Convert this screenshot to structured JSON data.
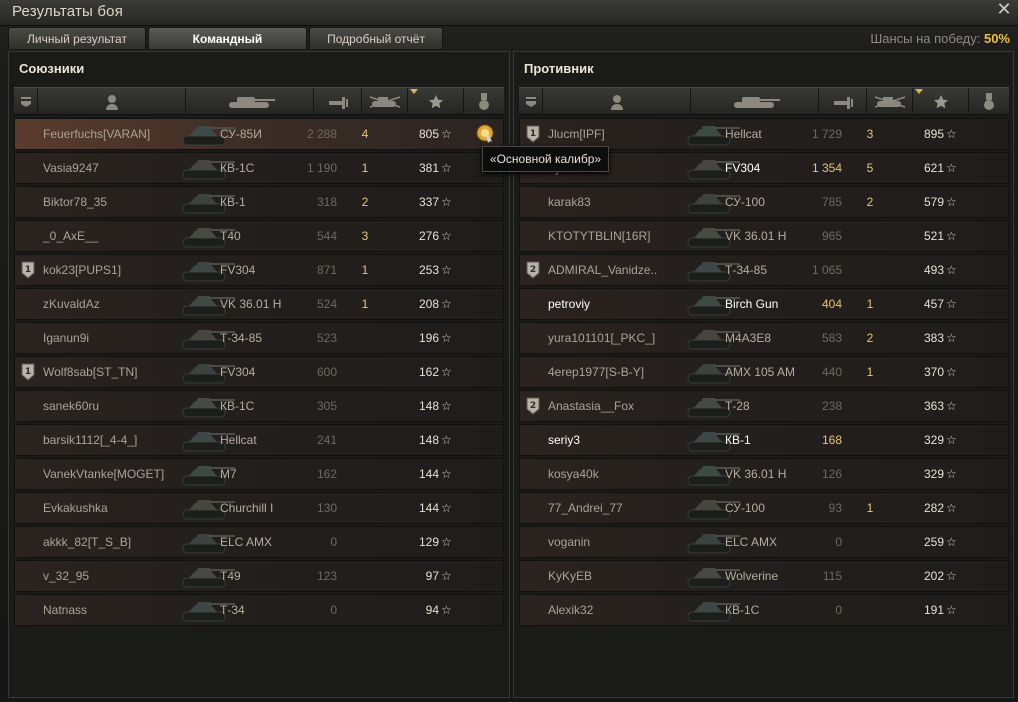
{
  "window": {
    "title": "Результаты боя",
    "close_label": "✕"
  },
  "tabs": [
    {
      "label": "Личный результат",
      "active": false
    },
    {
      "label": "Командный результат",
      "active": true
    },
    {
      "label": "Подробный отчёт",
      "active": false
    }
  ],
  "win_chance": {
    "label": "Шансы на победу:",
    "value": "50%"
  },
  "columns": {
    "icons": [
      "clan-badge-icon",
      "player-icon",
      "tank-icon",
      "damage-icon",
      "kills-icon",
      "xp-star-icon",
      "medal-icon"
    ],
    "sort_column": "xp"
  },
  "allies": {
    "title": "Союзники",
    "rows": [
      {
        "badge": "",
        "name": "Feuerfuchs[VARAN]",
        "tank": "СУ-85И",
        "damage": "2 288",
        "kills": "4",
        "xp": "805",
        "medal": "main-caliber",
        "me": true,
        "alive": false
      },
      {
        "badge": "",
        "name": "Vasia9247",
        "tank": "КВ-1С",
        "damage": "1 190",
        "kills": "1",
        "xp": "381",
        "medal": "",
        "alive": false
      },
      {
        "badge": "",
        "name": "Biktor78_35",
        "tank": "КВ-1",
        "damage": "318",
        "kills": "2",
        "xp": "337",
        "medal": "",
        "alive": false
      },
      {
        "badge": "",
        "name": "_0_AxE__",
        "tank": "T40",
        "damage": "544",
        "kills": "3",
        "xp": "276",
        "medal": "",
        "alive": false
      },
      {
        "badge": "1",
        "name": "kok23[PUPS1]",
        "tank": "FV304",
        "damage": "871",
        "kills": "1",
        "xp": "253",
        "medal": "",
        "alive": false
      },
      {
        "badge": "",
        "name": "zKuvaldAz",
        "tank": "VK 36.01 H",
        "damage": "524",
        "kills": "1",
        "xp": "208",
        "medal": "",
        "alive": false
      },
      {
        "badge": "",
        "name": "Iganun9i",
        "tank": "Т-34-85",
        "damage": "523",
        "kills": "",
        "xp": "196",
        "medal": "",
        "alive": false
      },
      {
        "badge": "1",
        "name": "Wolf8sab[ST_TN]",
        "tank": "FV304",
        "damage": "600",
        "kills": "",
        "xp": "162",
        "medal": "",
        "alive": false
      },
      {
        "badge": "",
        "name": "sanek60ru",
        "tank": "КВ-1С",
        "damage": "305",
        "kills": "",
        "xp": "148",
        "medal": "",
        "alive": false
      },
      {
        "badge": "",
        "name": "barsik1112[_4-4_]",
        "tank": "Hellcat",
        "damage": "241",
        "kills": "",
        "xp": "148",
        "medal": "",
        "alive": false
      },
      {
        "badge": "",
        "name": "VanekVtanke[MOGET]",
        "tank": "M7",
        "damage": "162",
        "kills": "",
        "xp": "144",
        "medal": "",
        "alive": false
      },
      {
        "badge": "",
        "name": "Evkakushka",
        "tank": "Churchill I",
        "damage": "130",
        "kills": "",
        "xp": "144",
        "medal": "",
        "alive": false
      },
      {
        "badge": "",
        "name": "akkk_82[T_S_B]",
        "tank": "ELC AMX",
        "damage": "0",
        "kills": "",
        "xp": "129",
        "medal": "",
        "alive": false
      },
      {
        "badge": "",
        "name": "v_32_95",
        "tank": "T49",
        "damage": "123",
        "kills": "",
        "xp": "97",
        "medal": "",
        "alive": false
      },
      {
        "badge": "",
        "name": "Natnass",
        "tank": "Т-34",
        "damage": "0",
        "kills": "",
        "xp": "94",
        "medal": "",
        "alive": false
      }
    ]
  },
  "enemies": {
    "title": "Противник",
    "rows": [
      {
        "badge": "1",
        "name": "Jlucm[IPF]",
        "tank": "Hellcat",
        "damage": "1 729",
        "kills": "3",
        "xp": "895",
        "medal": "",
        "alive": false
      },
      {
        "badge": "",
        "name": "F]",
        "tank": "FV304",
        "damage": "1 354",
        "kills": "5",
        "xp": "621",
        "medal": "",
        "alive": true
      },
      {
        "badge": "",
        "name": "karak83",
        "tank": "СУ-100",
        "damage": "785",
        "kills": "2",
        "xp": "579",
        "medal": "",
        "alive": false
      },
      {
        "badge": "",
        "name": "KTOTYTBLIN[16R]",
        "tank": "VK 36.01 H",
        "damage": "965",
        "kills": "",
        "xp": "521",
        "medal": "",
        "alive": false
      },
      {
        "badge": "2",
        "name": "ADMIRAL_Vanidze..",
        "tank": "Т-34-85",
        "damage": "1 065",
        "kills": "",
        "xp": "493",
        "medal": "",
        "alive": false
      },
      {
        "badge": "",
        "name": "petroviy",
        "tank": "Birch Gun",
        "damage": "404",
        "kills": "1",
        "xp": "457",
        "medal": "",
        "alive": true
      },
      {
        "badge": "",
        "name": "yura101101[_PKC_]",
        "tank": "M4A3E8",
        "damage": "583",
        "kills": "2",
        "xp": "383",
        "medal": "",
        "alive": false
      },
      {
        "badge": "",
        "name": "4erep1977[S-B-Y]",
        "tank": "AMX 105 AM",
        "damage": "440",
        "kills": "1",
        "xp": "370",
        "medal": "",
        "alive": false
      },
      {
        "badge": "2",
        "name": "Anastasia__Fox",
        "tank": "Т-28",
        "damage": "238",
        "kills": "",
        "xp": "363",
        "medal": "",
        "alive": false
      },
      {
        "badge": "",
        "name": "seriy3",
        "tank": "КВ-1",
        "damage": "168",
        "kills": "",
        "xp": "329",
        "medal": "",
        "alive": true
      },
      {
        "badge": "",
        "name": "kosya40k",
        "tank": "VK 36.01 H",
        "damage": "126",
        "kills": "",
        "xp": "329",
        "medal": "",
        "alive": false
      },
      {
        "badge": "",
        "name": "77_Andrei_77",
        "tank": "СУ-100",
        "damage": "93",
        "kills": "1",
        "xp": "282",
        "medal": "",
        "alive": false
      },
      {
        "badge": "",
        "name": "voganin",
        "tank": "ELC AMX",
        "damage": "0",
        "kills": "",
        "xp": "259",
        "medal": "",
        "alive": false
      },
      {
        "badge": "",
        "name": "KyKyEB",
        "tank": "Wolverine",
        "damage": "115",
        "kills": "",
        "xp": "202",
        "medal": "",
        "alive": false
      },
      {
        "badge": "",
        "name": "Alexik32",
        "tank": "КВ-1С",
        "damage": "0",
        "kills": "",
        "xp": "191",
        "medal": "",
        "alive": false
      }
    ]
  },
  "tooltip": {
    "text": "«Основной калибр»"
  },
  "star_glyph": "☆"
}
